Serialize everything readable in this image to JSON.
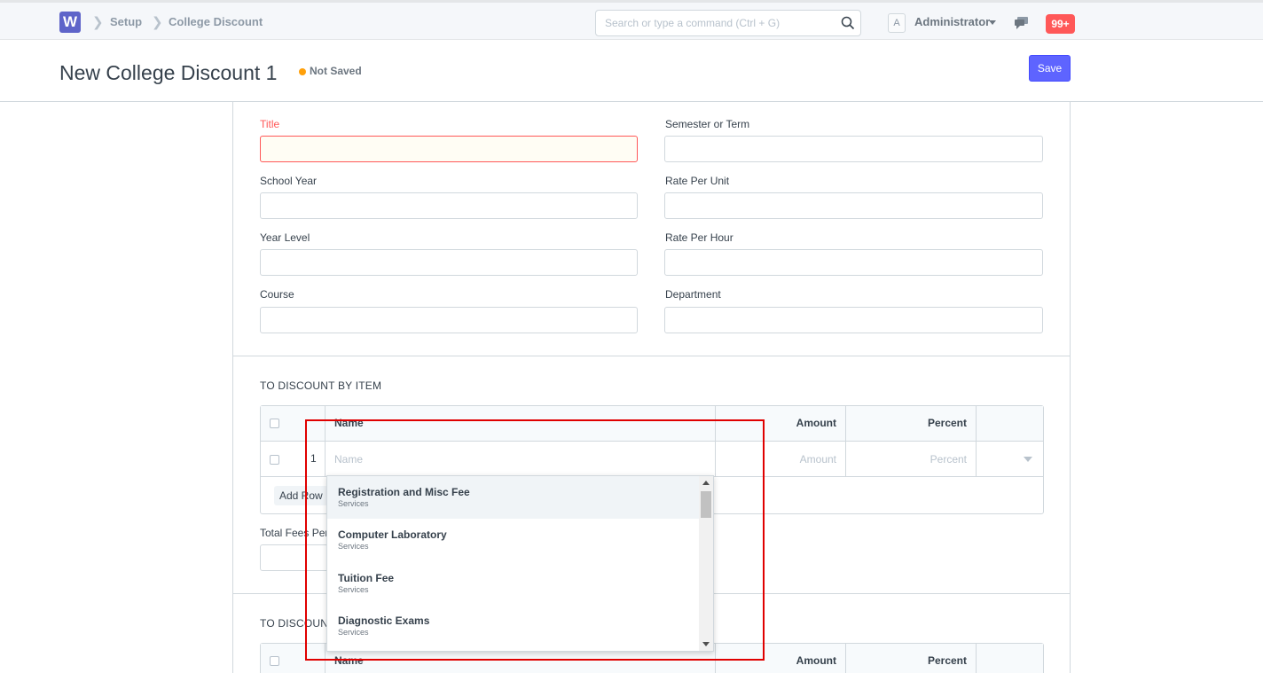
{
  "nav": {
    "logo_letter": "W",
    "breadcrumbs": [
      "Setup",
      "College Discount"
    ],
    "search_placeholder": "Search or type a command (Ctrl + G)",
    "avatar_letter": "A",
    "user_name": "Administrator",
    "notification_count": "99+"
  },
  "page": {
    "title": "New College Discount 1",
    "status": "Not Saved",
    "save_label": "Save",
    "status_color": "#ffa00a",
    "accent_color": "#5e64ff"
  },
  "form": {
    "left_fields": [
      {
        "label": "Title",
        "value": "",
        "required": true
      },
      {
        "label": "School Year",
        "value": ""
      },
      {
        "label": "Year Level",
        "value": ""
      },
      {
        "label": "Course",
        "value": ""
      }
    ],
    "right_fields": [
      {
        "label": "Semester or Term",
        "value": ""
      },
      {
        "label": "Rate Per Unit",
        "value": ""
      },
      {
        "label": "Rate Per Hour",
        "value": ""
      },
      {
        "label": "Department",
        "value": ""
      }
    ]
  },
  "item_section": {
    "title": "TO DISCOUNT BY ITEM",
    "columns": [
      "Name",
      "Amount",
      "Percent"
    ],
    "row": {
      "index": "1",
      "name_placeholder": "Name",
      "amount_placeholder": "Amount",
      "percent_placeholder": "Percent"
    },
    "add_row_label": "Add Row",
    "total_label": "Total Fees Per"
  },
  "second_section": {
    "title": "TO DISCOUNT",
    "columns": [
      "Name",
      "Amount",
      "Percent"
    ]
  },
  "dropdown": {
    "items": [
      {
        "name": "Registration and Misc Fee",
        "group": "Services"
      },
      {
        "name": "Computer Laboratory",
        "group": "Services"
      },
      {
        "name": "Tuition Fee",
        "group": "Services"
      },
      {
        "name": "Diagnostic Exams",
        "group": "Services"
      }
    ]
  },
  "annotation": {
    "highlight_color": "#e00000"
  }
}
